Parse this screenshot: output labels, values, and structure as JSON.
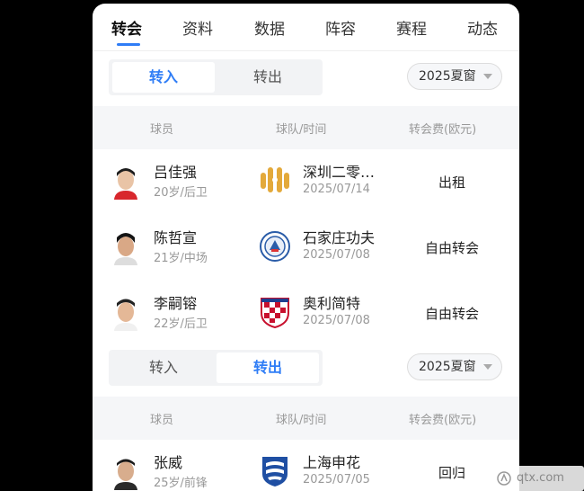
{
  "tabs": [
    {
      "label": "转会",
      "active": true
    },
    {
      "label": "资料",
      "active": false
    },
    {
      "label": "数据",
      "active": false
    },
    {
      "label": "阵容",
      "active": false
    },
    {
      "label": "赛程",
      "active": false
    },
    {
      "label": "动态",
      "active": false
    }
  ],
  "transfer_in": {
    "seg_in": "转入",
    "seg_out": "转出",
    "active_seg": "转入",
    "season": "2025夏窗",
    "headers": {
      "player": "球员",
      "club_time": "球队/时间",
      "fee": "转会费(欧元)"
    },
    "rows": [
      {
        "name": "吕佳强",
        "info": "20岁/后卫",
        "club": "深圳二零…",
        "date": "2025/07/14",
        "fee": "出租"
      },
      {
        "name": "陈哲宣",
        "info": "21岁/中场",
        "club": "石家庄功夫",
        "date": "2025/07/08",
        "fee": "自由转会"
      },
      {
        "name": "李嗣镕",
        "info": "22岁/后卫",
        "club": "奥利简特",
        "date": "2025/07/08",
        "fee": "自由转会"
      }
    ]
  },
  "transfer_out": {
    "seg_in": "转入",
    "seg_out": "转出",
    "active_seg": "转出",
    "season": "2025夏窗",
    "headers": {
      "player": "球员",
      "club_time": "球队/时间",
      "fee": "转会费(欧元)"
    },
    "rows": [
      {
        "name": "张威",
        "info": "25岁/前锋",
        "club": "上海申花",
        "date": "2025/07/05",
        "fee": "回归"
      }
    ]
  },
  "watermark": {
    "text": "qtx.com"
  },
  "colors": {
    "accent": "#2f7df6",
    "background": "#000000"
  }
}
